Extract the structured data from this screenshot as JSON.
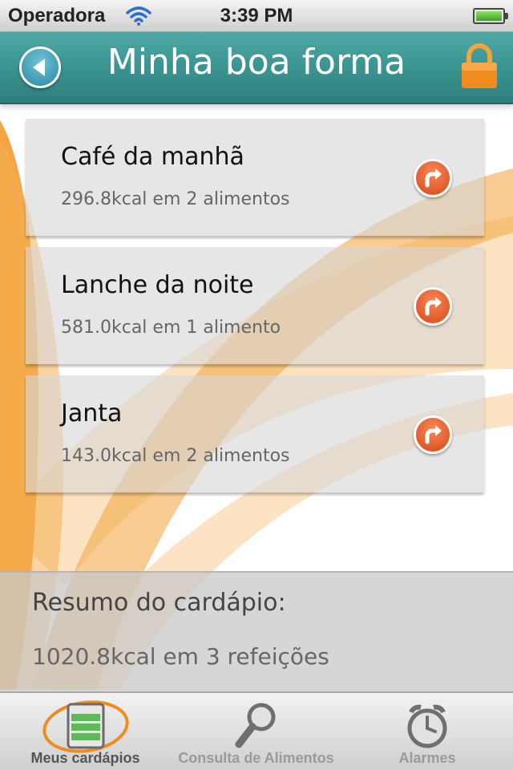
{
  "status_bar": {
    "carrier": "Operadora",
    "time": "3:39 PM"
  },
  "header": {
    "title": "Minha boa forma"
  },
  "meals": [
    {
      "name": "Café da manhã",
      "summary": "296.8kcal em 2 alimentos"
    },
    {
      "name": "Lanche da noite",
      "summary": "581.0kcal em 1 alimento"
    },
    {
      "name": "Janta",
      "summary": "143.0kcal em 2 alimentos"
    }
  ],
  "summary": {
    "title": "Resumo do cardápio:",
    "total": "1020.8kcal em 3 refeições"
  },
  "tabs": [
    {
      "label": "Meus cardápios",
      "icon": "menu-list-icon",
      "active": true
    },
    {
      "label": "Consulta de Alimentos",
      "icon": "magnifier-icon",
      "active": false
    },
    {
      "label": "Alarmes",
      "icon": "alarm-clock-icon",
      "active": false
    }
  ],
  "colors": {
    "header": "#3d9693",
    "accent_orange": "#f39a2c",
    "go_button": "#e0571c",
    "lock": "#f08c1e"
  }
}
